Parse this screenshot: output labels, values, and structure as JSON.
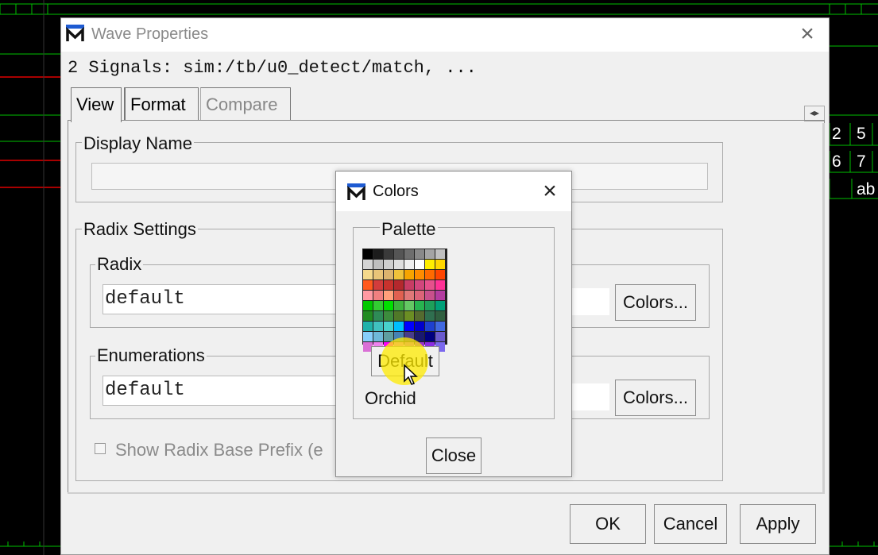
{
  "background": {
    "labels": [
      "2",
      "5",
      "6",
      "7",
      "ab"
    ]
  },
  "window": {
    "title": "Wave Properties",
    "signals_line": "2 Signals: sim:/tb/u0_detect/match, ...",
    "tabs": [
      {
        "label": "View",
        "active": true
      },
      {
        "label": "Format",
        "active": false
      },
      {
        "label": "Compare",
        "active": false,
        "disabled": true
      }
    ],
    "display_name": {
      "legend": "Display Name",
      "value": ""
    },
    "radix_settings": {
      "legend": "Radix Settings",
      "radix_legend": "Radix",
      "radix_value": "default",
      "enumerations_legend": "Enumerations",
      "enumerations_value": "default",
      "colors_button": "Colors...",
      "show_prefix_label": "Show Radix Base Prefix (e"
    },
    "buttons": {
      "ok": "OK",
      "cancel": "Cancel",
      "apply": "Apply"
    }
  },
  "colors_dialog": {
    "title": "Colors",
    "palette_legend": "Palette",
    "default_button": "Default",
    "color_name": "Orchid",
    "close_button": "Close",
    "palette_colors": [
      "#000000",
      "#1c1c1c",
      "#3a3a3a",
      "#555555",
      "#6e6e6e",
      "#898989",
      "#a4a4a4",
      "#c0c0c0",
      "#d4d4d4",
      "#bfbfbf",
      "#cfcfcf",
      "#dedede",
      "#efefef",
      "#ffffff",
      "#ffee00",
      "#ffd700",
      "#f5d98c",
      "#e8c478",
      "#dcb46e",
      "#f0c23a",
      "#f7a400",
      "#ff8c00",
      "#ff6a00",
      "#ff4500",
      "#ff5a1e",
      "#d23c3c",
      "#c8322d",
      "#b4282d",
      "#c83c64",
      "#d2467d",
      "#e6508c",
      "#ff3296",
      "#ff9aa2",
      "#f08080",
      "#ffa07a",
      "#e06050",
      "#e07878",
      "#dc6478",
      "#c8508c",
      "#b43ca0",
      "#00c800",
      "#32cd32",
      "#00e000",
      "#3cb43c",
      "#64c864",
      "#28b450",
      "#1ea05a",
      "#00a078",
      "#228b22",
      "#2e8b57",
      "#3c8c3c",
      "#507828",
      "#6b8e23",
      "#556b2f",
      "#2f6f4f",
      "#306040",
      "#20b2aa",
      "#40c0c0",
      "#48d1cc",
      "#00bfff",
      "#0000ff",
      "#0000cd",
      "#1e40d0",
      "#4169e1",
      "#87cefa",
      "#6fb8d8",
      "#5f9ea0",
      "#4682b4",
      "#483d8b",
      "#191970",
      "#000080",
      "#6a5acd",
      "#da70d6",
      "#ee82ee",
      "#ff00ff",
      "#dd66dd",
      "#ba55d3",
      "#9932cc",
      "#8a2be2",
      "#7b68ee"
    ]
  }
}
